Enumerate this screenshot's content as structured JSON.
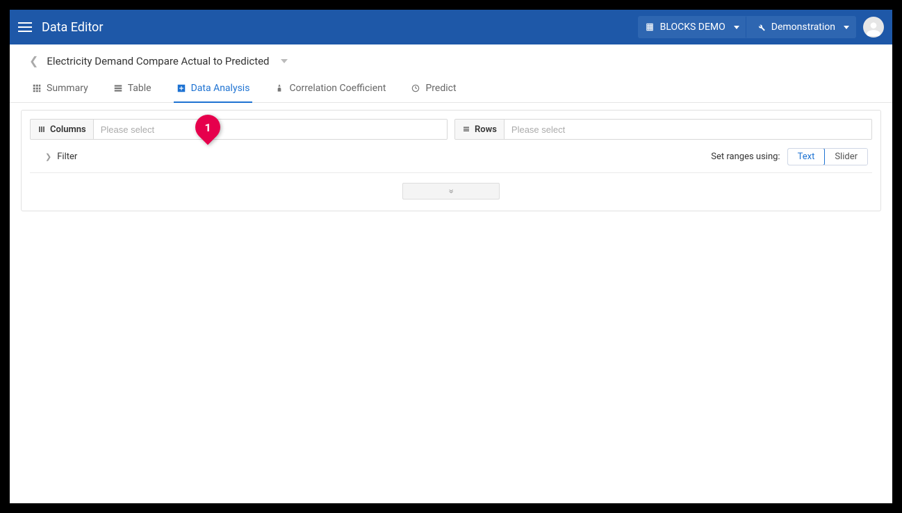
{
  "app": {
    "title": "Data Editor"
  },
  "breadcrumbs": {
    "project": "BLOCKS DEMO",
    "section": "Demonstration"
  },
  "page": {
    "title": "Electricity Demand Compare Actual to Predicted"
  },
  "tabs": {
    "summary": "Summary",
    "table": "Table",
    "data_analysis": "Data Analysis",
    "correlation": "Correlation Coefficient",
    "predict": "Predict"
  },
  "marker": {
    "label": "1"
  },
  "selectors": {
    "columns_label": "Columns",
    "columns_placeholder": "Please select",
    "rows_label": "Rows",
    "rows_placeholder": "Please select"
  },
  "filter": {
    "label": "Filter",
    "range_label": "Set ranges using:",
    "option_text": "Text",
    "option_slider": "Slider"
  }
}
